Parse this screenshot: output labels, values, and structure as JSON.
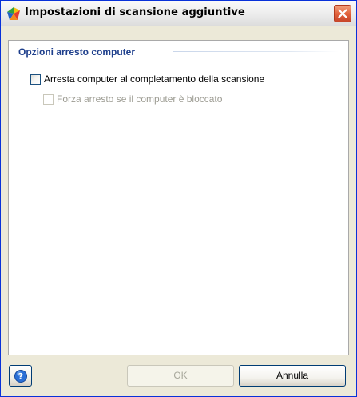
{
  "window": {
    "title": "Impostazioni di scansione aggiuntive",
    "app_icon": "avg-logo-icon",
    "close_icon": "close-icon"
  },
  "section": {
    "title": "Opzioni arresto computer"
  },
  "options": [
    {
      "label": "Arresta computer al completamento della scansione",
      "checked": false,
      "enabled": true
    },
    {
      "label": "Forza arresto se il computer è bloccato",
      "checked": false,
      "enabled": false
    }
  ],
  "footer": {
    "help_icon": "help-icon",
    "ok_label": "OK",
    "ok_enabled": false,
    "cancel_label": "Annulla"
  },
  "colors": {
    "section_title": "#1e3f8c",
    "disabled_text": "#9d9c93",
    "window_bg": "#ece9d8",
    "close_button": "#e2623c"
  }
}
